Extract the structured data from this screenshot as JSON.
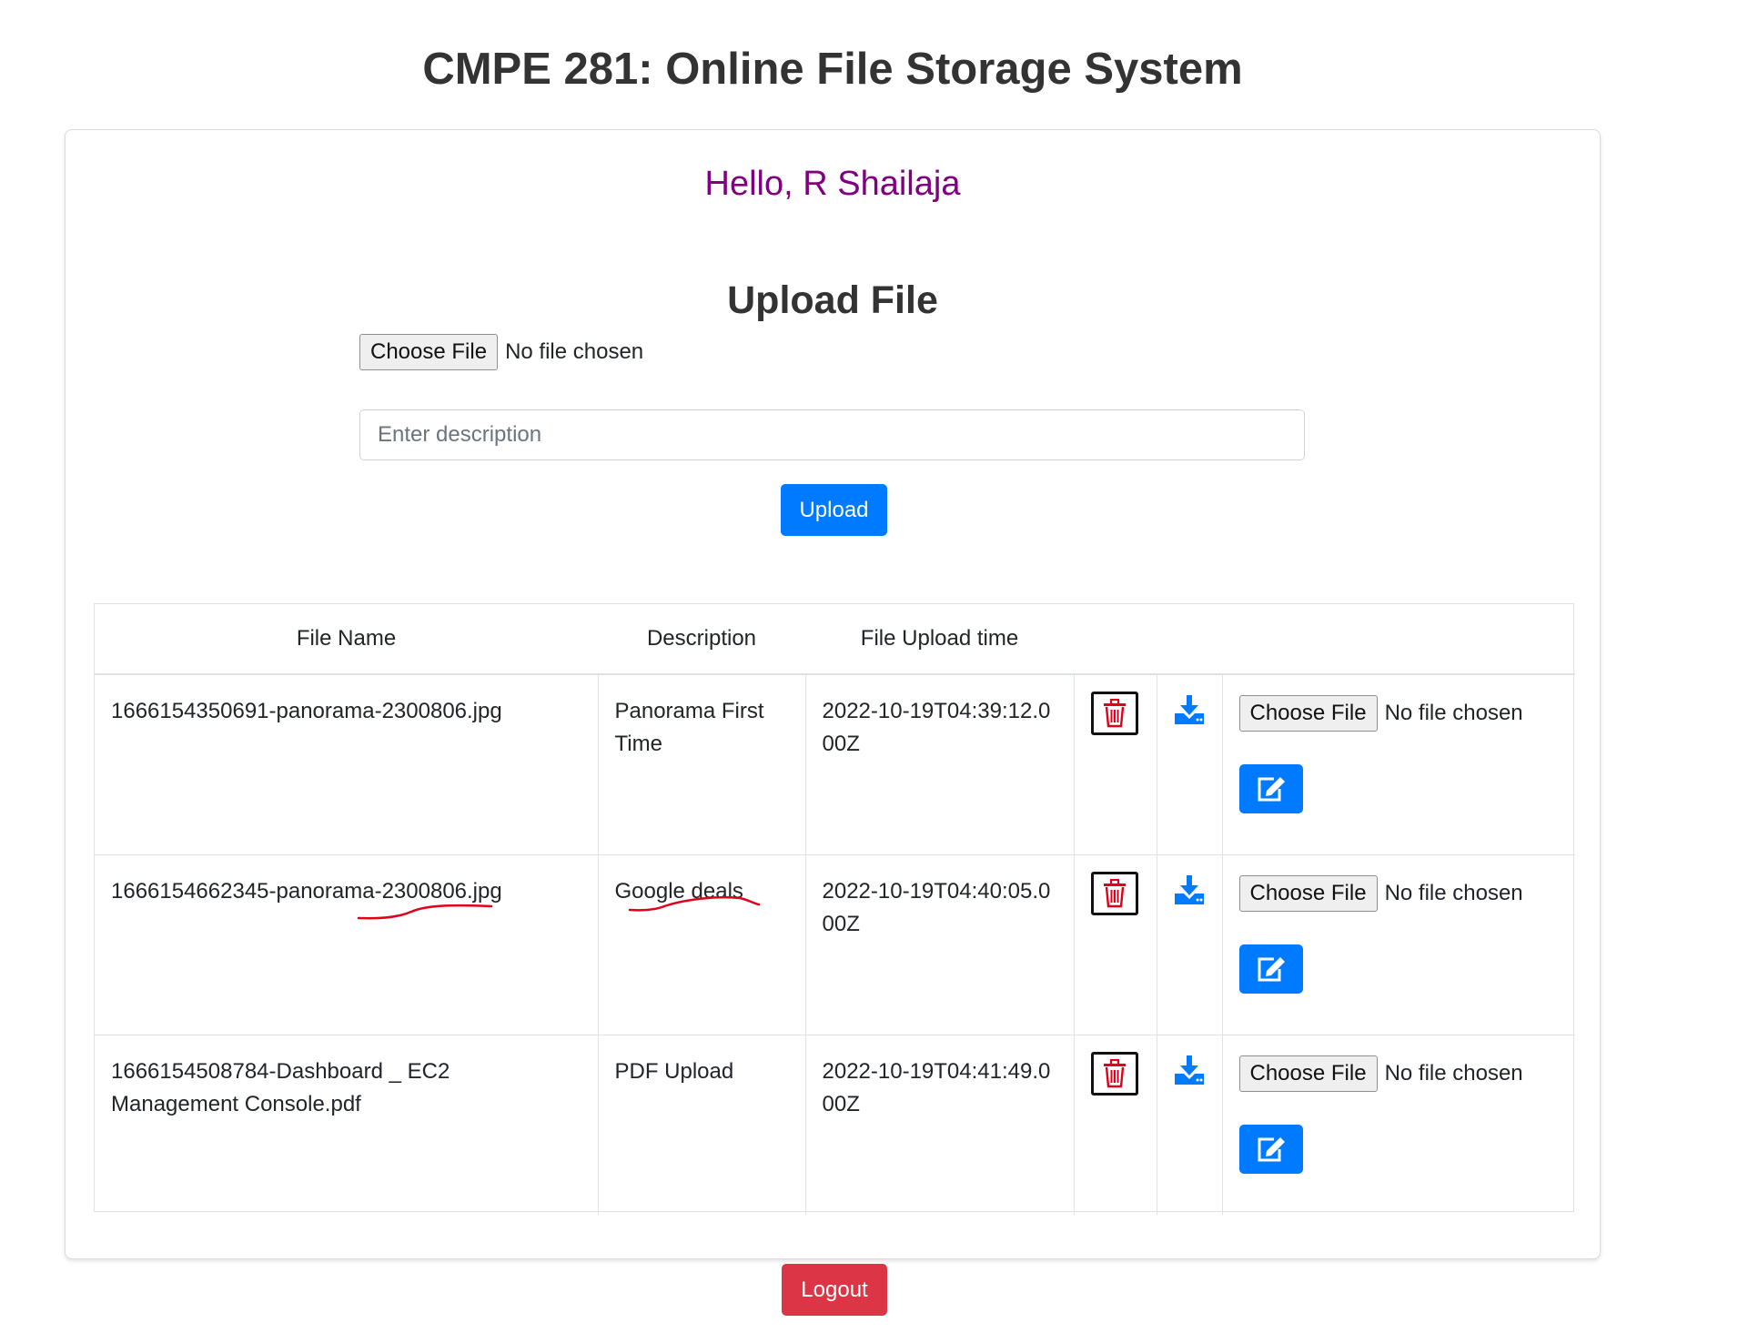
{
  "header": {
    "title": "CMPE 281: Online File Storage System"
  },
  "greeting": "Hello, R Shailaja",
  "upload": {
    "heading": "Upload File",
    "choose_file_label": "Choose File",
    "no_file_text": "No file chosen",
    "description_placeholder": "Enter description",
    "upload_label": "Upload"
  },
  "table": {
    "columns": [
      "File Name",
      "Description",
      "File Upload time",
      "",
      "",
      ""
    ],
    "rows": [
      {
        "file_name": "1666154350691-panorama-2300806.jpg",
        "description": "Panorama First Time",
        "upload_time": "2022-10-19T04:39:12.000Z",
        "choose_file_label": "Choose File",
        "no_file_text": "No file chosen"
      },
      {
        "file_name": "1666154662345-panorama-2300806.jpg",
        "description": "Google deals",
        "upload_time": "2022-10-19T04:40:05.000Z",
        "choose_file_label": "Choose File",
        "no_file_text": "No file chosen"
      },
      {
        "file_name": "1666154508784-Dashboard _ EC2 Management Console.pdf",
        "description": "PDF Upload",
        "upload_time": "2022-10-19T04:41:49.000Z",
        "choose_file_label": "Choose File",
        "no_file_text": "No file chosen"
      }
    ]
  },
  "icons": {
    "delete": "trash-icon",
    "download": "download-icon",
    "edit": "edit-icon"
  },
  "colors": {
    "primary": "#007bff",
    "danger": "#dc3545",
    "greeting": "#800080",
    "annotation": "#e0001a"
  },
  "logout_label": "Logout"
}
